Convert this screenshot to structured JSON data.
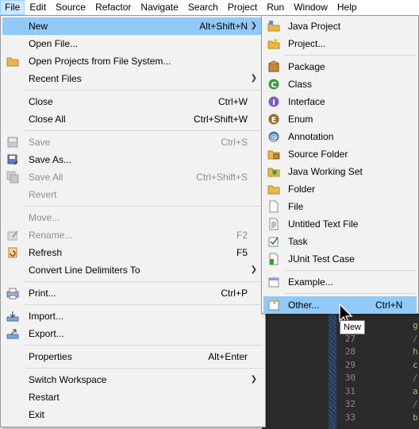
{
  "menubar": [
    "File",
    "Edit",
    "Source",
    "Refactor",
    "Navigate",
    "Search",
    "Project",
    "Run",
    "Window",
    "Help"
  ],
  "file_menu": {
    "new": {
      "label": "New",
      "shortcut": "Alt+Shift+N"
    },
    "open_file": "Open File...",
    "open_projects": "Open Projects from File System...",
    "recent_files": "Recent Files",
    "close": {
      "label": "Close",
      "shortcut": "Ctrl+W"
    },
    "close_all": {
      "label": "Close All",
      "shortcut": "Ctrl+Shift+W"
    },
    "save": {
      "label": "Save",
      "shortcut": "Ctrl+S"
    },
    "save_as": "Save As...",
    "save_all": {
      "label": "Save All",
      "shortcut": "Ctrl+Shift+S"
    },
    "revert": "Revert",
    "move": "Move...",
    "rename": {
      "label": "Rename...",
      "shortcut": "F2"
    },
    "refresh": {
      "label": "Refresh",
      "shortcut": "F5"
    },
    "convert": "Convert Line Delimiters To",
    "print": {
      "label": "Print...",
      "shortcut": "Ctrl+P"
    },
    "import": "Import...",
    "export": "Export...",
    "properties": {
      "label": "Properties",
      "shortcut": "Alt+Enter"
    },
    "switch_workspace": "Switch Workspace",
    "restart": "Restart",
    "exit": "Exit"
  },
  "new_menu": {
    "java_project": "Java Project",
    "project": "Project...",
    "package": "Package",
    "class": "Class",
    "interface": "Interface",
    "enum": "Enum",
    "annotation": "Annotation",
    "source_folder": "Source Folder",
    "java_working_set": "Java Working Set",
    "folder": "Folder",
    "file": "File",
    "untitled_text_file": "Untitled Text File",
    "task": "Task",
    "junit_test_case": "JUnit Test Case",
    "example": "Example...",
    "other": {
      "label": "Other...",
      "shortcut": "Ctrl+N"
    }
  },
  "tooltip": "New",
  "editor": {
    "line_numbers": [
      "27",
      "28",
      "29",
      "30",
      "31",
      "32",
      "33"
    ],
    "code_chars": [
      {
        "text": "g",
        "color": "#a5c25c"
      },
      {
        "text": "/",
        "color": "#629755"
      },
      {
        "text": "h",
        "color": "#a5c25c"
      },
      {
        "text": "c",
        "color": "#a5c25c"
      },
      {
        "text": "/",
        "color": "#629755"
      },
      {
        "text": "a",
        "color": "#a5c25c"
      },
      {
        "text": "/",
        "color": "#629755"
      },
      {
        "text": "b",
        "color": "#a5c25c"
      }
    ]
  },
  "colors": {
    "highlight": "#91c9f7",
    "menubar_active": "#cce8ff",
    "menu_bg": "#f2f2f2"
  }
}
